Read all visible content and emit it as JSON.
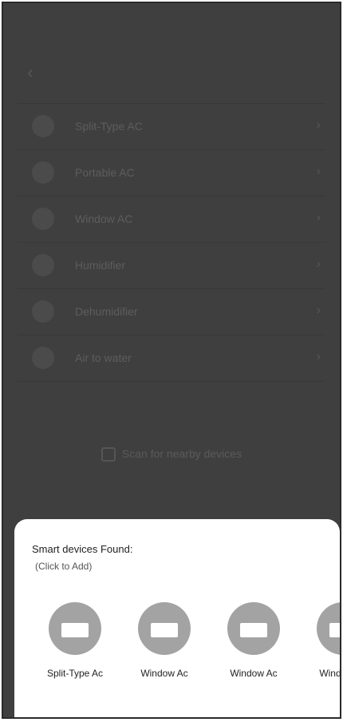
{
  "background": {
    "status_bar": {
      "time": "",
      "icons": ""
    },
    "header": {
      "title": "",
      "subtitle": ""
    },
    "list": [
      {
        "label": "Split-Type AC"
      },
      {
        "label": "Portable AC"
      },
      {
        "label": "Window AC"
      },
      {
        "label": "Humidifier"
      },
      {
        "label": "Dehumidifier"
      },
      {
        "label": "Air to water"
      }
    ],
    "note": "",
    "scan_label": "Scan for nearby devices",
    "scan_hint": ""
  },
  "sheet": {
    "title": "Smart devices Found:",
    "hint": "(Click to Add)",
    "devices": [
      {
        "label": "Split-Type Ac",
        "icon": "ac-unit-icon"
      },
      {
        "label": "Window Ac",
        "icon": "ac-unit-icon"
      },
      {
        "label": "Window Ac",
        "icon": "ac-unit-icon"
      },
      {
        "label": "Window Ac",
        "icon": "ac-unit-icon"
      }
    ]
  },
  "colors": {
    "overlay": "#3f3f3f",
    "sheet_bg": "#ffffff",
    "device_circle": "#a3a3a3"
  }
}
